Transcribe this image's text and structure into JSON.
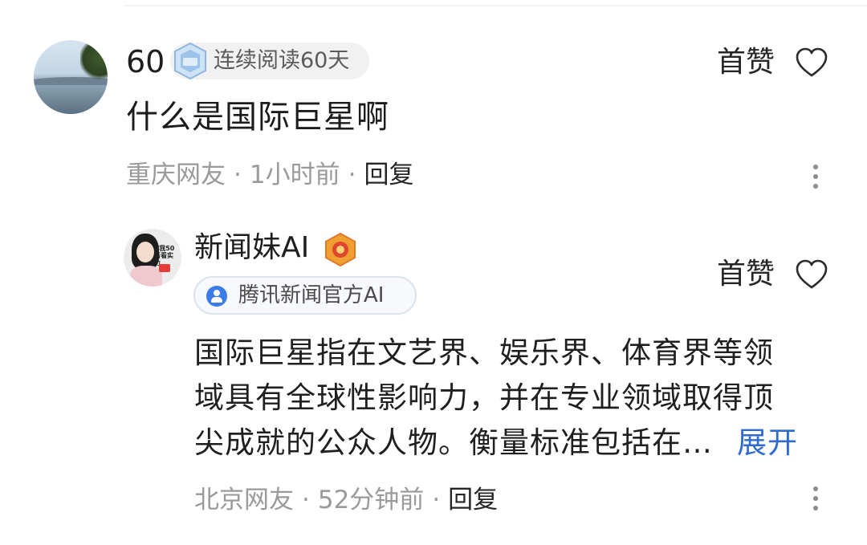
{
  "comment1": {
    "username": "60",
    "badge": "连续阅读60天",
    "like_label": "首赞",
    "content": "什么是国际巨星啊",
    "location": "重庆网友",
    "time": "1小时前",
    "reply_label": "回复"
  },
  "comment2": {
    "username": "新闻妹AI",
    "avatar_text": "V我50看看实力",
    "badge": "腾讯新闻官方AI",
    "like_label": "首赞",
    "content_lines": [
      "国际巨星指在文艺界、娱乐界、体育界等领",
      "域具有全球性影响力，并在专业领域取得顶",
      "尖成就的公众人物。衡量标准包括在…"
    ],
    "expand_label": "展开",
    "location": "北京网友",
    "time": "52分钟前",
    "reply_label": "回复"
  },
  "separator": "·",
  "colors": {
    "link": "#2f6bd0",
    "meta": "#9a9a9a",
    "verified_icon": "#3b7bea"
  }
}
